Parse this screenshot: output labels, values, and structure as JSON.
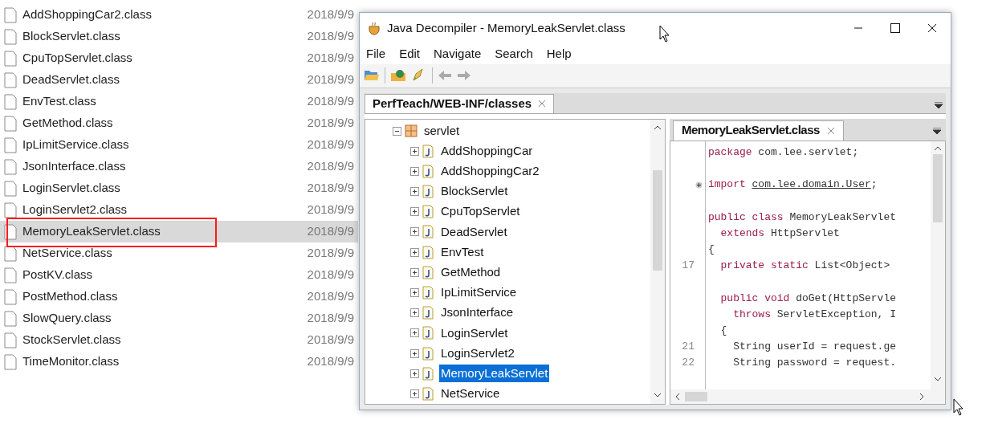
{
  "explorer": {
    "files": [
      {
        "name": "AddShoppingCar2.class",
        "date": "2018/9/9",
        "selected": false
      },
      {
        "name": "BlockServlet.class",
        "date": "2018/9/9",
        "selected": false
      },
      {
        "name": "CpuTopServlet.class",
        "date": "2018/9/9",
        "selected": false
      },
      {
        "name": "DeadServlet.class",
        "date": "2018/9/9",
        "selected": false
      },
      {
        "name": "EnvTest.class",
        "date": "2018/9/9",
        "selected": false
      },
      {
        "name": "GetMethod.class",
        "date": "2018/9/9",
        "selected": false
      },
      {
        "name": "IpLimitService.class",
        "date": "2018/9/9",
        "selected": false
      },
      {
        "name": "JsonInterface.class",
        "date": "2018/9/9",
        "selected": false
      },
      {
        "name": "LoginServlet.class",
        "date": "2018/9/9",
        "selected": false
      },
      {
        "name": "LoginServlet2.class",
        "date": "2018/9/9",
        "selected": false
      },
      {
        "name": "MemoryLeakServlet.class",
        "date": "2018/9/9",
        "selected": true
      },
      {
        "name": "NetService.class",
        "date": "2018/9/9",
        "selected": false
      },
      {
        "name": "PostKV.class",
        "date": "2018/9/9",
        "selected": false
      },
      {
        "name": "PostMethod.class",
        "date": "2018/9/9",
        "selected": false
      },
      {
        "name": "SlowQuery.class",
        "date": "2018/9/9",
        "selected": false
      },
      {
        "name": "StockServlet.class",
        "date": "2018/9/9",
        "selected": false
      },
      {
        "name": "TimeMonitor.class",
        "date": "2018/9/9",
        "selected": false
      }
    ]
  },
  "window": {
    "title": "Java Decompiler - MemoryLeakServlet.class",
    "menu": [
      "File",
      "Edit",
      "Navigate",
      "Search",
      "Help"
    ],
    "tabs": [
      {
        "label": "PerfTeach/WEB-INF/classes",
        "selected": true
      }
    ],
    "tree": {
      "label": "servlet",
      "expanded": true,
      "children": [
        {
          "label": "AddShoppingCar",
          "expanded": false,
          "selected": false
        },
        {
          "label": "AddShoppingCar2",
          "expanded": false,
          "selected": false
        },
        {
          "label": "BlockServlet",
          "expanded": false,
          "selected": false
        },
        {
          "label": "CpuTopServlet",
          "expanded": false,
          "selected": false
        },
        {
          "label": "DeadServlet",
          "expanded": false,
          "selected": false
        },
        {
          "label": "EnvTest",
          "expanded": false,
          "selected": false
        },
        {
          "label": "GetMethod",
          "expanded": false,
          "selected": false
        },
        {
          "label": "IpLimitService",
          "expanded": false,
          "selected": false
        },
        {
          "label": "JsonInterface",
          "expanded": false,
          "selected": false
        },
        {
          "label": "LoginServlet",
          "expanded": false,
          "selected": false
        },
        {
          "label": "LoginServlet2",
          "expanded": false,
          "selected": false
        },
        {
          "label": "MemoryLeakServlet",
          "expanded": false,
          "selected": true
        },
        {
          "label": "NetService",
          "expanded": false,
          "selected": false
        }
      ]
    },
    "editor_tabs": [
      {
        "label": "MemoryLeakServlet.class",
        "selected": true
      }
    ],
    "code": [
      {
        "tokens": [
          {
            "text": "package",
            "kind": "keyword"
          },
          {
            "text": " com.lee.servlet;",
            "kind": "plain"
          }
        ]
      },
      {
        "gap_before": true,
        "folded": true,
        "tokens": [
          {
            "text": "import ",
            "kind": "keyword"
          },
          {
            "text": "com.lee.domain.User",
            "kind": "link"
          },
          {
            "text": ";",
            "kind": "plain"
          }
        ]
      },
      {
        "gap_before": true,
        "tokens": [
          {
            "text": "public class",
            "kind": "keyword"
          },
          {
            "text": " MemoryLeakServlet",
            "kind": "plain"
          }
        ]
      },
      {
        "tokens": [
          {
            "text": "  extends",
            "kind": "keyword"
          },
          {
            "text": " HttpServlet",
            "kind": "plain"
          }
        ]
      },
      {
        "tokens": [
          {
            "text": "{",
            "kind": "plain"
          }
        ]
      },
      {
        "number": "17",
        "tokens": [
          {
            "text": "  private static",
            "kind": "keyword"
          },
          {
            "text": " List<Object>",
            "kind": "plain"
          }
        ]
      },
      {
        "gap_before": true,
        "tokens": [
          {
            "text": "  public void",
            "kind": "keyword"
          },
          {
            "text": " doGet(HttpServle",
            "kind": "plain"
          }
        ]
      },
      {
        "tokens": [
          {
            "text": "    throws",
            "kind": "keyword"
          },
          {
            "text": " ServletException, I",
            "kind": "plain"
          }
        ]
      },
      {
        "tokens": [
          {
            "text": "  {",
            "kind": "plain"
          }
        ]
      },
      {
        "number": "21",
        "tokens": [
          {
            "text": "    String userId = request.ge",
            "kind": "plain"
          }
        ]
      },
      {
        "number": "22",
        "tokens": [
          {
            "text": "    String password = request.",
            "kind": "plain"
          }
        ]
      }
    ]
  }
}
